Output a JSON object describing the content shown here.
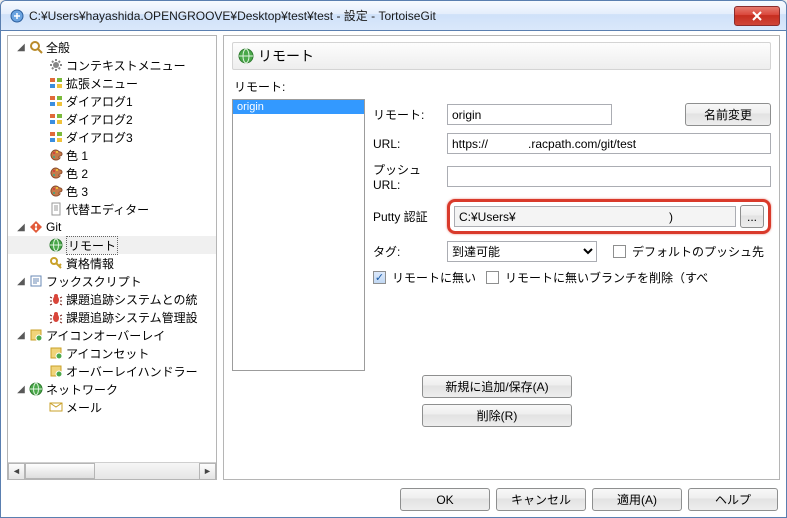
{
  "window": {
    "title": "C:¥Users¥hayashida.OPENGROOVE¥Desktop¥test¥test - 設定 - TortoiseGit"
  },
  "tree": {
    "items": [
      {
        "depth": 0,
        "expand": "open",
        "icon": "search",
        "label": "全般"
      },
      {
        "depth": 1,
        "expand": "none",
        "icon": "gear",
        "label": "コンテキストメニュー"
      },
      {
        "depth": 1,
        "expand": "none",
        "icon": "win",
        "label": "拡張メニュー"
      },
      {
        "depth": 1,
        "expand": "none",
        "icon": "win",
        "label": "ダイアログ1"
      },
      {
        "depth": 1,
        "expand": "none",
        "icon": "win",
        "label": "ダイアログ2"
      },
      {
        "depth": 1,
        "expand": "none",
        "icon": "win",
        "label": "ダイアログ3"
      },
      {
        "depth": 1,
        "expand": "none",
        "icon": "palette",
        "label": "色 1"
      },
      {
        "depth": 1,
        "expand": "none",
        "icon": "palette",
        "label": "色 2"
      },
      {
        "depth": 1,
        "expand": "none",
        "icon": "palette",
        "label": "色 3"
      },
      {
        "depth": 1,
        "expand": "none",
        "icon": "doc",
        "label": "代替エディター"
      },
      {
        "depth": 0,
        "expand": "open",
        "icon": "git",
        "label": "Git"
      },
      {
        "depth": 1,
        "expand": "none",
        "icon": "globe",
        "label": "リモート",
        "selected": true
      },
      {
        "depth": 1,
        "expand": "none",
        "icon": "key",
        "label": "資格情報"
      },
      {
        "depth": 0,
        "expand": "open",
        "icon": "hook",
        "label": "フックスクリプト"
      },
      {
        "depth": 1,
        "expand": "none",
        "icon": "bug",
        "label": "課題追跡システムとの統"
      },
      {
        "depth": 1,
        "expand": "none",
        "icon": "bug",
        "label": "課題追跡システム管理設"
      },
      {
        "depth": 0,
        "expand": "open",
        "icon": "overlay",
        "label": "アイコンオーバーレイ"
      },
      {
        "depth": 1,
        "expand": "none",
        "icon": "overlay",
        "label": "アイコンセット"
      },
      {
        "depth": 1,
        "expand": "none",
        "icon": "overlay",
        "label": "オーバーレイハンドラー"
      },
      {
        "depth": 0,
        "expand": "open",
        "icon": "globe",
        "label": "ネットワーク"
      },
      {
        "depth": 1,
        "expand": "none",
        "icon": "mail",
        "label": "メール"
      }
    ]
  },
  "section": {
    "title": "リモート"
  },
  "remote": {
    "list_label": "リモート:",
    "selected": "origin",
    "fields": {
      "remote_label": "リモート:",
      "remote_value": "origin",
      "url_label": "URL:",
      "url_value": "https://            .racpath.com/git/test",
      "push_url_label": "プッシュ URL:",
      "push_url_value": "",
      "putty_label": "Putty 認証",
      "putty_value": "C:¥Users¥                                              )",
      "tag_label": "タグ:",
      "tag_value": "到達可能"
    },
    "buttons": {
      "rename": "名前変更",
      "browse": "...",
      "add_save": "新規に追加/保存(A)",
      "delete": "削除(R)"
    },
    "checks": {
      "default_push_label": "デフォルトのプッシュ先",
      "default_push": false,
      "prune1_label": "リモートに無い",
      "prune1": true,
      "prune2_label": "リモートに無いブランチを削除（すべ",
      "prune2": false
    }
  },
  "footer": {
    "ok": "OK",
    "cancel": "キャンセル",
    "apply": "適用(A)",
    "help": "ヘルプ"
  }
}
